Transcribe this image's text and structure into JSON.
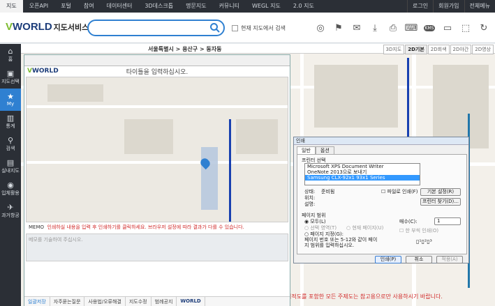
{
  "topnav": {
    "items": [
      "지도",
      "오픈API",
      "포털",
      "참여",
      "데이터센터",
      "3D데스크톱",
      "명문지도",
      "커뮤니티",
      "WEGL 지도",
      "2.0 지도"
    ],
    "right": [
      "로그인",
      "회원가입",
      "전체메뉴"
    ]
  },
  "header": {
    "logo_brand": "WORLD",
    "logo_v": "V",
    "logo_sub": "지도서비스",
    "search_placeholder": "",
    "search_in_map_label": "현재 지도에서 검색",
    "tool_icons": [
      "binoculars-icon",
      "measure-icon",
      "mail-icon",
      "download-icon",
      "print-icon",
      "keyboard-icon",
      "km-icon",
      "screen-icon",
      "crop-icon",
      "refresh-icon"
    ],
    "km_label": "KMS"
  },
  "leftnav": {
    "items": [
      {
        "label": "홈",
        "icon": "home-icon",
        "glyph": "⌂"
      },
      {
        "label": "지도선택",
        "icon": "map-select-icon",
        "glyph": "▣"
      },
      {
        "label": "My",
        "icon": "star-icon",
        "glyph": "★"
      },
      {
        "label": "통계",
        "icon": "stats-icon",
        "glyph": "▥"
      },
      {
        "label": "검색",
        "icon": "search-icon",
        "glyph": "⚲"
      },
      {
        "label": "실내지도",
        "icon": "indoor-icon",
        "glyph": "▤"
      },
      {
        "label": "입체활용",
        "icon": "globe-icon",
        "glyph": "◉"
      },
      {
        "label": "과거항공",
        "icon": "plane-icon",
        "glyph": "✈"
      }
    ]
  },
  "mapbar": {
    "breadcrumb": "서울특별시 > 용산구 > 동자동",
    "modes": [
      "3D지도",
      "2D기본",
      "2D회색",
      "2D야간",
      "2D영상"
    ]
  },
  "printwin": {
    "logo": "WORLD",
    "title_placeholder": "타이틀을 입력하십시오.",
    "memo_label": "MEMO",
    "memo_notice": "인쇄하실 내용을 입력 후 인쇄하기를 클릭하세요. 브라우저 설정에 따라 결과가 다를 수 있습니다.",
    "memo_placeholder": "메모를 기술하여 주십시오.",
    "tabs": [
      "일괄저장",
      "자주묻는질문",
      "사용법/오류해결",
      "지도수정",
      "범례공지"
    ],
    "footer_logo": "WORLD"
  },
  "dialog": {
    "title": "인쇄",
    "tabs": [
      "일반",
      "옵션"
    ],
    "printer_select_label": "프린터 선택",
    "printers": [
      "Microsoft XPS Document Writer",
      "OneNote 2013으로 보내기",
      "Samsung CLX-92x1 93x1 Series"
    ],
    "status_label": "상태:",
    "status_value": "준비됨",
    "location_label": "위치:",
    "comment_label": "설명:",
    "print_to_file": "파일로 인쇄(F)",
    "prefs_button": "기본 설정(R)",
    "find_button": "프린터 찾기(D)...",
    "range_label": "페이지 범위",
    "range_all": "모두(L)",
    "range_selection": "선택 영역(T)",
    "range_current": "현재 페이지(U)",
    "range_pages": "페이지 지정(G):",
    "range_hint": "페이지 번호 또는 5-12와 같이 페이지 범위를 입력하십시오.",
    "copies_label": "매수(C):",
    "copies_value": "1",
    "collate_label": "한 부씩 인쇄(O)",
    "print_button": "인쇄(P)",
    "cancel_button": "취소",
    "apply_button": "적용(A)"
  },
  "map_warning": "지적도를 포함한 모든 주제도는 참고용으로만 사용하시기 바랍니다.",
  "colors": {
    "accent": "#2f80d1",
    "topbar": "#2b2f36",
    "metro": "#1840b0",
    "warning": "#d12a2a"
  }
}
